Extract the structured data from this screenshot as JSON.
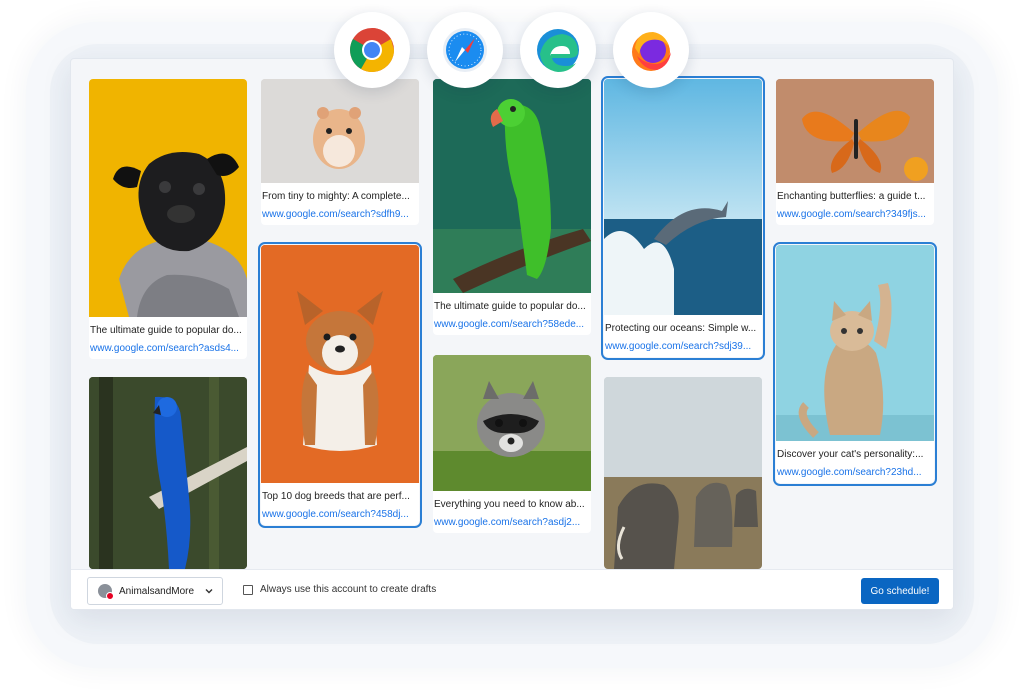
{
  "browsers": [
    {
      "icon": "chrome-icon"
    },
    {
      "icon": "safari-icon"
    },
    {
      "icon": "edge-icon"
    },
    {
      "icon": "firefox-icon"
    }
  ],
  "cards": [
    {
      "caption": "The ultimate guide to popular do...",
      "url": "www.google.com/search?asds4...",
      "image": "pug-image",
      "selected": false
    },
    {
      "caption": "",
      "url": "",
      "image": "blue-macaw-image",
      "selected": false
    },
    {
      "caption": "From tiny to mighty: A complete...",
      "url": "www.google.com/search?sdfh9...",
      "image": "hamster-image",
      "selected": false
    },
    {
      "caption": "Top 10 dog breeds that are perf...",
      "url": "www.google.com/search?458dj...",
      "image": "corgi-image",
      "selected": true
    },
    {
      "caption": "The ultimate guide to popular do...",
      "url": "www.google.com/search?58ede...",
      "image": "parrot-image",
      "selected": false
    },
    {
      "caption": "Everything you need to know ab...",
      "url": "www.google.com/search?asdj2...",
      "image": "raccoon-image",
      "selected": false
    },
    {
      "caption": "Protecting our oceans: Simple w...",
      "url": "www.google.com/search?sdj39...",
      "image": "dolphin-image",
      "selected": true
    },
    {
      "caption": "",
      "url": "",
      "image": "elephants-image",
      "selected": false
    },
    {
      "caption": "Enchanting butterflies: a guide t...",
      "url": "www.google.com/search?349fjs...",
      "image": "butterfly-image",
      "selected": false
    },
    {
      "caption": "Discover your cat's personality:...",
      "url": "www.google.com/search?23hd...",
      "image": "kitten-image",
      "selected": true
    }
  ],
  "footer": {
    "account_name": "AnimalsandMore",
    "checkbox_label": "Always use this account to create drafts",
    "go_button": "Go schedule!"
  },
  "colors": {
    "accent": "#0a66c2",
    "link": "#1a73e8",
    "selected_outline": "#2b7fd4"
  }
}
